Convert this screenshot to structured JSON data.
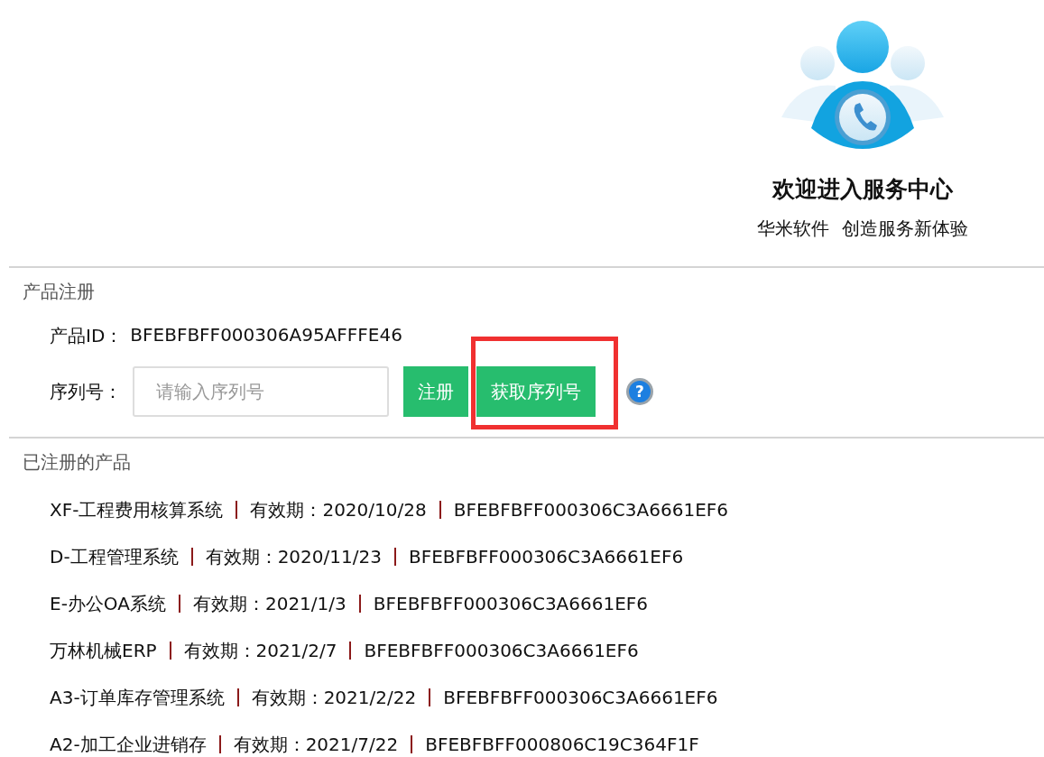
{
  "header": {
    "title": "欢迎进入服务中心",
    "subtitle_parts": [
      "华米软件",
      "创造服务新体验"
    ]
  },
  "registration": {
    "heading": "产品注册",
    "product_id_label": "产品ID：",
    "product_id": "BFEBFBFF000306A95AFFFE46",
    "serial_label": "序列号：",
    "serial_field": {
      "placeholder": "请输入序列号"
    },
    "help_symbol": "?",
    "buttons": [
      {
        "label": "注册",
        "highlighted": false
      },
      {
        "label": "获取序列号",
        "highlighted": true
      }
    ]
  },
  "registered": {
    "heading": "已注册的产品",
    "products": [
      {
        "name": "XF-工程费用核算系统",
        "validity": "有效期：2020/10/28",
        "serial": "BFEBFBFF000306C3A6661EF6"
      },
      {
        "name": "D-工程管理系统",
        "validity": "有效期：2020/11/23",
        "serial": "BFEBFBFF000306C3A6661EF6"
      },
      {
        "name": "E-办公OA系统",
        "validity": "有效期：2021/1/3",
        "serial": "BFEBFBFF000306C3A6661EF6"
      },
      {
        "name": "万林机械ERP",
        "validity": "有效期：2021/2/7",
        "serial": "BFEBFBFF000306C3A6661EF6"
      },
      {
        "name": "A3-订单库存管理系统",
        "validity": "有效期：2021/2/22",
        "serial": "BFEBFBFF000306C3A6661EF6"
      },
      {
        "name": "A2-加工企业进销存",
        "validity": "有效期：2021/7/22",
        "serial": "BFEBFBFF000806C19C364F1F"
      }
    ]
  }
}
